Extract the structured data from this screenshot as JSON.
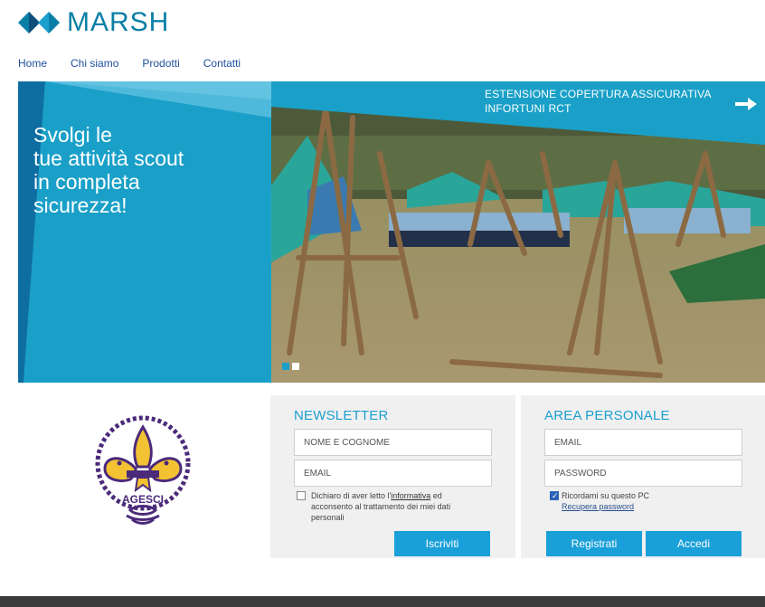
{
  "brand": {
    "name": "MARSH",
    "color": "#0a7fa6"
  },
  "nav": {
    "items": [
      {
        "label": "Home"
      },
      {
        "label": "Chi siamo"
      },
      {
        "label": "Prodotti"
      },
      {
        "label": "Contatti"
      }
    ]
  },
  "hero": {
    "headline_lines": [
      "Svolgi le",
      "tue attività scout",
      "in completa",
      "sicurezza!"
    ],
    "banner_lines": [
      "ESTENSIONE COPERTURA ASSICURATIVA",
      "INFORTUNI RCT"
    ],
    "arrow_icon": "arrow-right-icon",
    "slides": {
      "count": 2,
      "active_index": 0
    },
    "accent": "#1aa0c8"
  },
  "badge": {
    "text": "AGESCI"
  },
  "newsletter": {
    "title": "NEWSLETTER",
    "name_placeholder": "NOME E COGNOME",
    "email_placeholder": "EMAIL",
    "consent_prefix": "Dichiaro di aver letto l'",
    "consent_link": "informativa",
    "consent_suffix": " ed",
    "consent_line2": "acconsento al trattamento dei miei dati",
    "consent_line3": "personali",
    "consent_checked": false,
    "submit_label": "Iscriviti"
  },
  "area_personale": {
    "title": "AREA PERSONALE",
    "email_placeholder": "EMAIL",
    "password_placeholder": "PASSWORD",
    "remember_label": "Ricordami su questo PC",
    "remember_checked": true,
    "recover_link": "Recupera password",
    "register_label": "Registrati",
    "login_label": "Accedi"
  }
}
